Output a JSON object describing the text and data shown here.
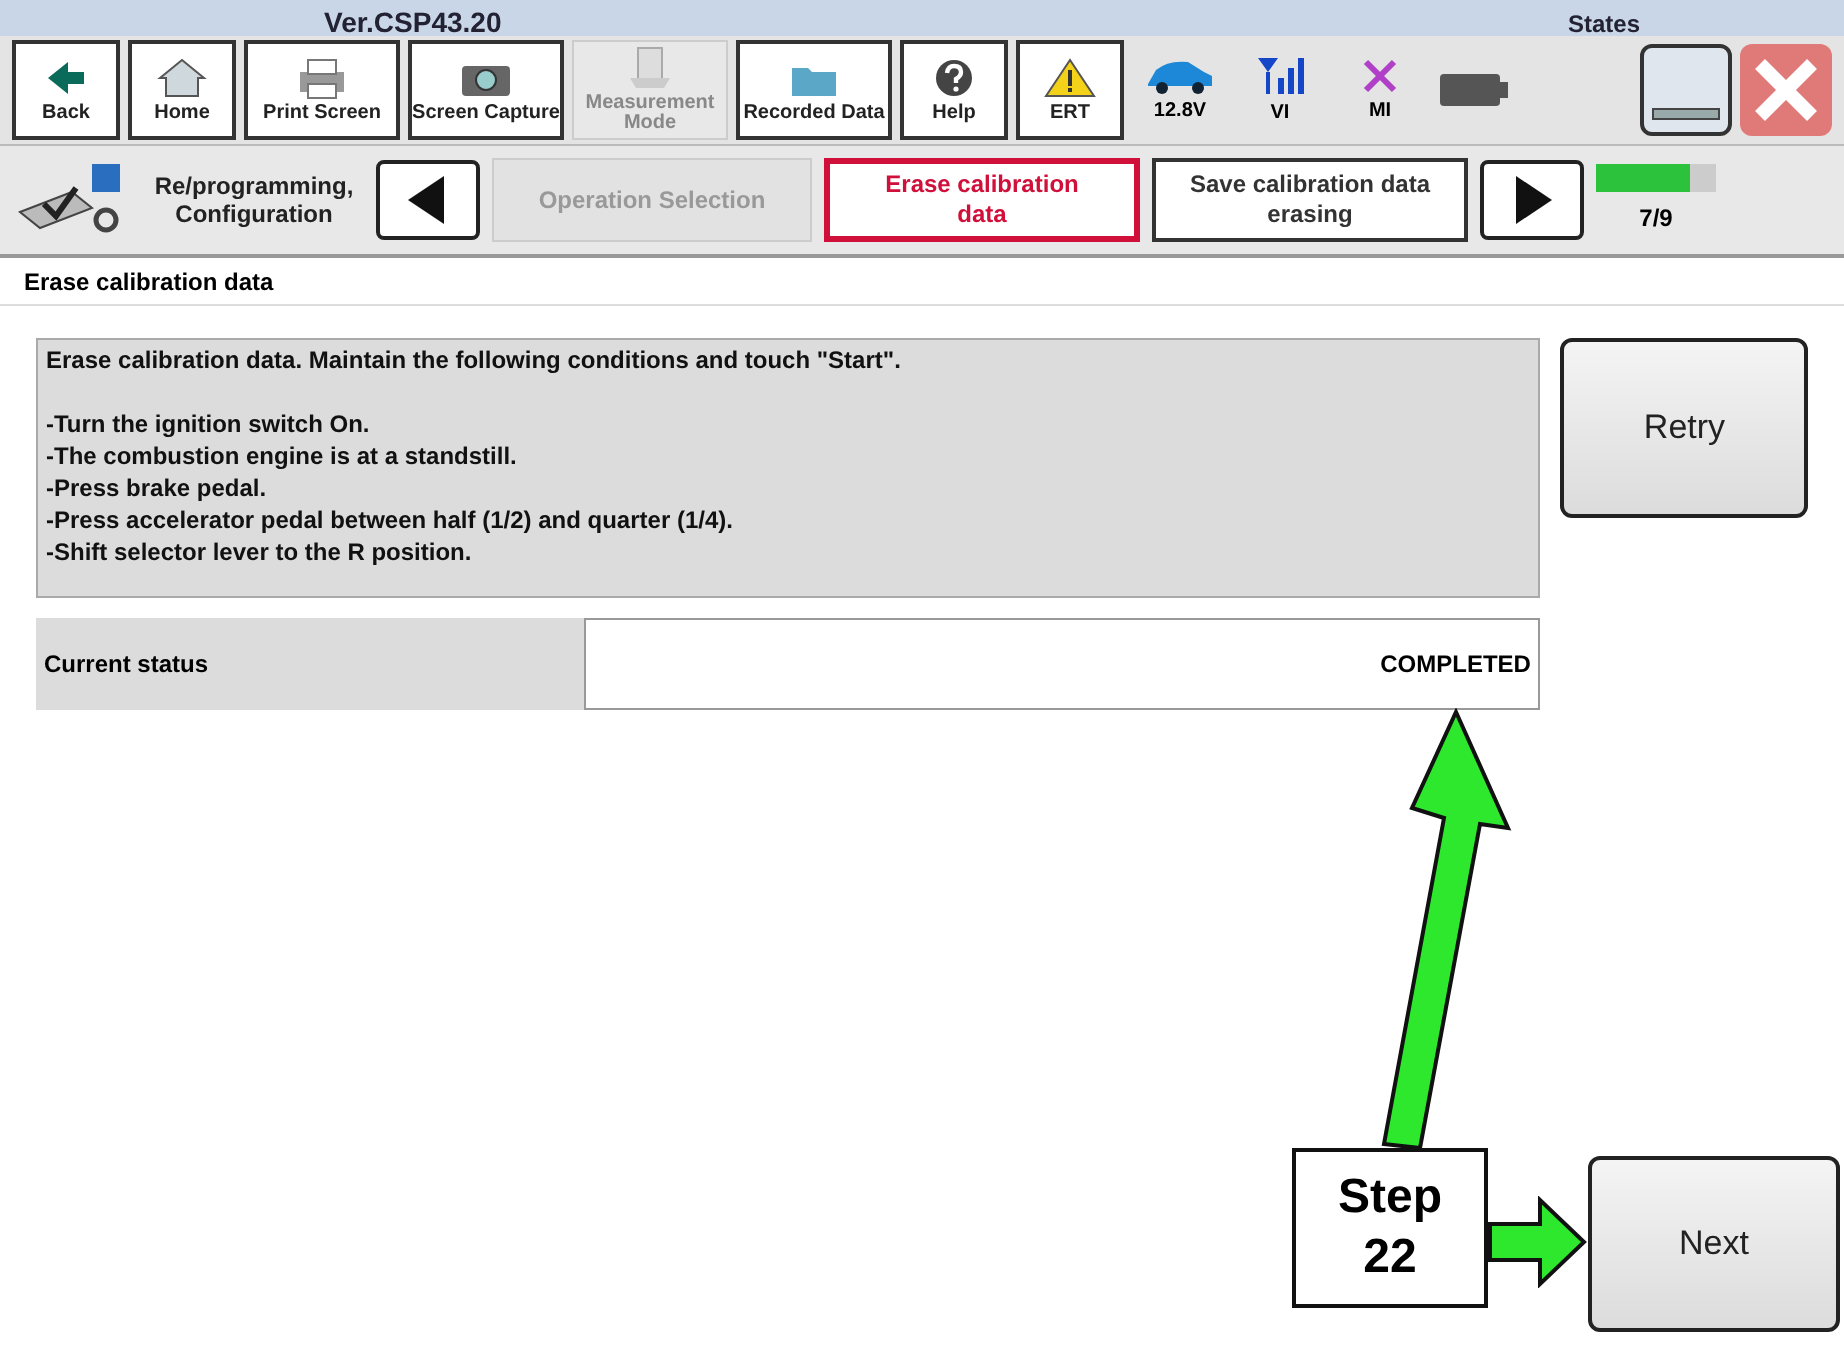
{
  "title_bar": {
    "version": "Ver.CSP43.20",
    "states_label": "States"
  },
  "toolbar": [
    {
      "label": "Back",
      "kind": "back",
      "disabled": false
    },
    {
      "label": "Home",
      "kind": "home",
      "disabled": false
    },
    {
      "label": "Print Screen",
      "kind": "print",
      "disabled": false
    },
    {
      "label": "Screen Capture",
      "kind": "camera",
      "disabled": false
    },
    {
      "label": "Measurement Mode",
      "kind": "measure",
      "disabled": true
    },
    {
      "label": "Recorded Data",
      "kind": "folder",
      "disabled": false
    },
    {
      "label": "Help",
      "kind": "help",
      "disabled": false
    },
    {
      "label": "ERT",
      "kind": "warning",
      "disabled": false
    }
  ],
  "status_icons": [
    {
      "label": "12.8V",
      "kind": "car"
    },
    {
      "label": "VI",
      "kind": "signal"
    },
    {
      "label": "MI",
      "kind": "cross"
    }
  ],
  "breadcrumb": {
    "mode": "Re/programming, Configuration",
    "steps": [
      {
        "label": "Operation Selection",
        "selected": false,
        "disabled": true
      },
      {
        "label": "Erase calibration data",
        "selected": true,
        "disabled": false
      },
      {
        "label": "Save calibration data erasing",
        "selected": false,
        "disabled": false
      }
    ],
    "progress": {
      "level": 0.78,
      "text": "7/9"
    }
  },
  "section_title": "Erase calibration data",
  "instructions": {
    "intro": "Erase calibration data. Maintain the following conditions and touch \"Start\".",
    "lines": [
      "-Turn the ignition switch On.",
      "-The combustion engine is at a standstill.",
      "-Press brake pedal.",
      "-Press accelerator pedal between half (1/2) and quarter (1/4).",
      "-Shift selector lever to the R position."
    ]
  },
  "status": {
    "label": "Current status",
    "value": "COMPLETED"
  },
  "buttons": {
    "retry": "Retry",
    "next": "Next"
  },
  "callout": {
    "text": "Step 22"
  }
}
